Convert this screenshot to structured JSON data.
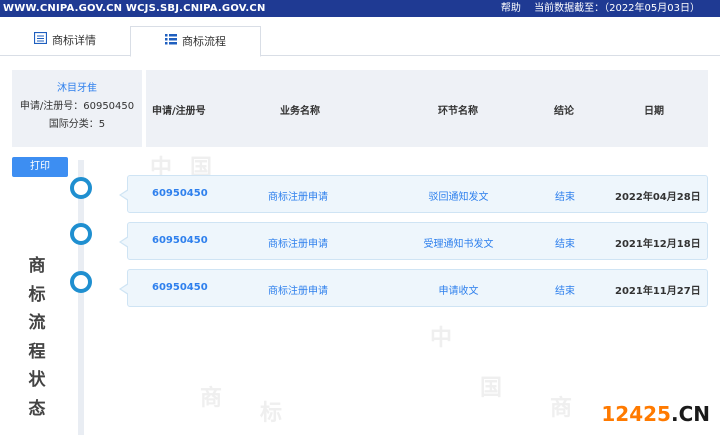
{
  "topbar": {
    "site": "WWW.CNIPA.GOV.CN WCJS.SBJ.CNIPA.GOV.CN",
    "help": "帮助",
    "data_as_of": "当前数据截至：（2022年05月03日）"
  },
  "tabs": [
    {
      "label": "商标详情",
      "icon": "document-icon"
    },
    {
      "label": "商标流程",
      "icon": "list-icon"
    }
  ],
  "info": {
    "name": "沐目牙隹",
    "reg_no": "申请/注册号：60950450",
    "intl_class": "国际分类：5"
  },
  "table_headers": {
    "reg_no": "申请/注册号",
    "business": "业务名称",
    "step": "环节名称",
    "result": "结论",
    "date": "日期"
  },
  "print_label": "打印",
  "vertical_title": [
    "商",
    "标",
    "流",
    "程",
    "状",
    "态"
  ],
  "rows": [
    {
      "reg_no": "60950450",
      "business": "商标注册申请",
      "step": "驳回通知发文",
      "result": "结束",
      "date": "2022年04月28日"
    },
    {
      "reg_no": "60950450",
      "business": "商标注册申请",
      "step": "受理通知书发文",
      "result": "结束",
      "date": "2021年12月18日"
    },
    {
      "reg_no": "60950450",
      "business": "商标注册申请",
      "step": "申请收文",
      "result": "结束",
      "date": "2021年11月27日"
    }
  ],
  "logo": {
    "num": "12425",
    "dom": ".CN"
  },
  "colors": {
    "topbar": "#1f3a93",
    "accent": "#2f80ed",
    "timeline": "#1f8fd0"
  }
}
